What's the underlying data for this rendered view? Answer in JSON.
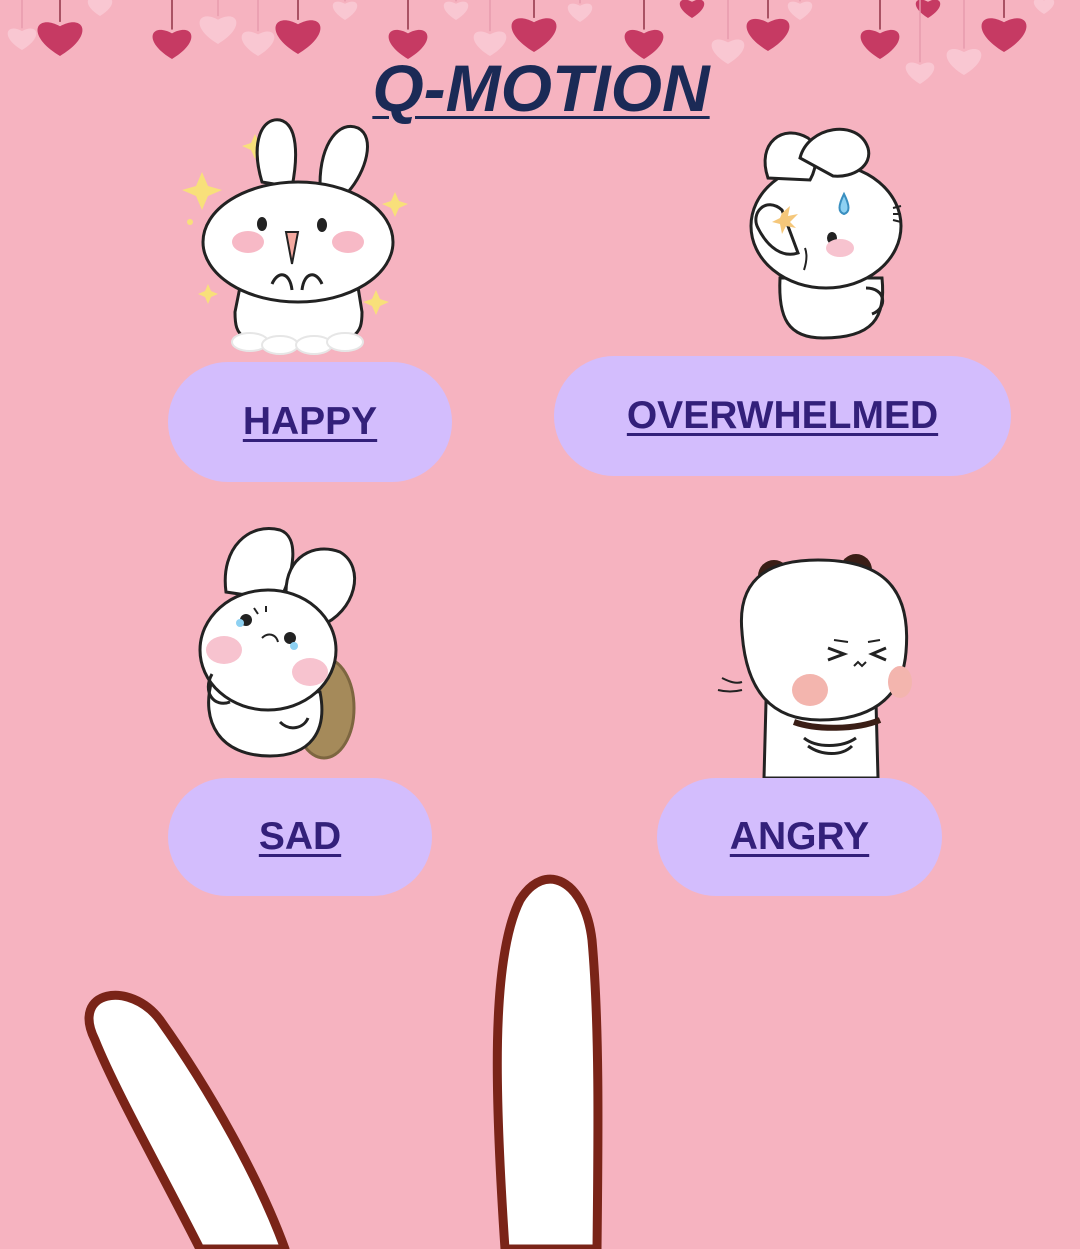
{
  "app": {
    "title": "Q-MOTION"
  },
  "emotions": [
    {
      "id": "happy",
      "label": "HAPPY",
      "icon": "happy-bunny-icon"
    },
    {
      "id": "overwhelmed",
      "label": "OVERWHELMED",
      "icon": "overwhelmed-bunny-icon"
    },
    {
      "id": "sad",
      "label": "SAD",
      "icon": "sad-bunny-icon"
    },
    {
      "id": "angry",
      "label": "ANGRY",
      "icon": "angry-bear-icon"
    }
  ],
  "colors": {
    "background": "#f6b3c0",
    "button_fill": "#d3bdfd",
    "button_text": "#33207a",
    "title_text": "#1b2a56",
    "heart": "#c63a63",
    "heart_light": "#f9c7d2"
  }
}
